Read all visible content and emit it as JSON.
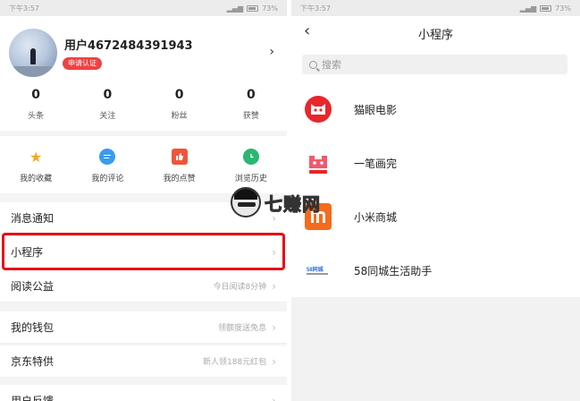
{
  "left": {
    "status": {
      "time": "下午3:57",
      "battery": "73%"
    },
    "profile": {
      "username": "用户4672484391943",
      "badge": "申请认证"
    },
    "stats": [
      {
        "value": "0",
        "label": "头条"
      },
      {
        "value": "0",
        "label": "关注"
      },
      {
        "value": "0",
        "label": "粉丝"
      },
      {
        "value": "0",
        "label": "获赞"
      }
    ],
    "quick": [
      {
        "label": "我的收藏",
        "icon": "star-icon",
        "color": "#f5a623"
      },
      {
        "label": "我的评论",
        "icon": "comment-icon",
        "color": "#3a9bf0"
      },
      {
        "label": "我的点赞",
        "icon": "thumbs-up-icon",
        "color": "#f0553a"
      },
      {
        "label": "浏览历史",
        "icon": "clock-icon",
        "color": "#2bb673"
      }
    ],
    "menu": [
      {
        "label": "消息通知",
        "right": ""
      },
      {
        "label": "小程序",
        "right": ""
      },
      {
        "label": "阅读公益",
        "right": "今日阅读8分钟"
      },
      {
        "label": "我的钱包",
        "right": "领额度送免息"
      },
      {
        "label": "京东特供",
        "right": "新人领188元红包"
      },
      {
        "label": "用户反馈",
        "right": ""
      }
    ]
  },
  "right": {
    "status": {
      "time": "下午3:57",
      "battery": "73%"
    },
    "title": "小程序",
    "search_placeholder": "搜索",
    "apps": [
      {
        "name": "猫眼电影",
        "icon": "maoyan-logo-icon",
        "color": "#e8262b"
      },
      {
        "name": "一笔画完",
        "icon": "yibihuawan-logo-icon",
        "color": "#f05a6e"
      },
      {
        "name": "小米商城",
        "icon": "xiaomi-logo-icon",
        "color": "#f56b1c"
      },
      {
        "name": "58同城生活助手",
        "icon": "58-logo-icon",
        "color": "#2a6ad8"
      }
    ]
  },
  "watermark": "七赚网"
}
